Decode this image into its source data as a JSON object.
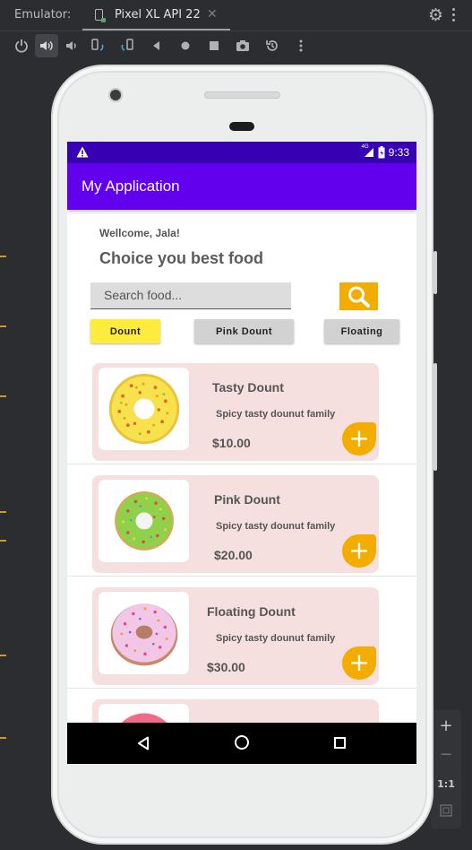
{
  "emulator": {
    "label": "Emulator:",
    "device_tab": "Pixel XL API 22",
    "tab_close": "✕",
    "toolbar_icons": [
      "power-icon",
      "volume-up-icon",
      "volume-down-icon",
      "rotate-left-icon",
      "rotate-right-icon",
      "back-icon",
      "home-icon",
      "overview-icon",
      "screenshot-icon",
      "snapshot-icon",
      "more-icon"
    ],
    "zoom": {
      "plus": "+",
      "minus": "−",
      "one_to_one": "1:1"
    }
  },
  "status_bar": {
    "signal": "4G",
    "time": "9:33"
  },
  "app_bar": {
    "title": "My Application",
    "color": "#6200ee",
    "status_color": "#3700b3"
  },
  "main": {
    "welcome": "Wellcome, Jala!",
    "headline": "Choice you best food",
    "search_placeholder": "Search food...",
    "accent_color": "#f3ad00",
    "categories": [
      {
        "label": "Dount",
        "selected": true
      },
      {
        "label": "Pink Dount",
        "selected": false
      },
      {
        "label": "Floating",
        "selected": false
      }
    ],
    "items": [
      {
        "name": "Tasty Dount",
        "desc": "Spicy tasty dounut family",
        "price": "$10.00",
        "add": "+",
        "image": "yellow-donut-image"
      },
      {
        "name": "Pink Dount",
        "desc": "Spicy tasty dounut family",
        "price": "$20.00",
        "add": "+",
        "image": "green-donut-image"
      },
      {
        "name": "Floating Dount",
        "desc": "Spicy tasty dounut family",
        "price": "$30.00",
        "add": "+",
        "image": "pink-donut-image"
      }
    ]
  }
}
